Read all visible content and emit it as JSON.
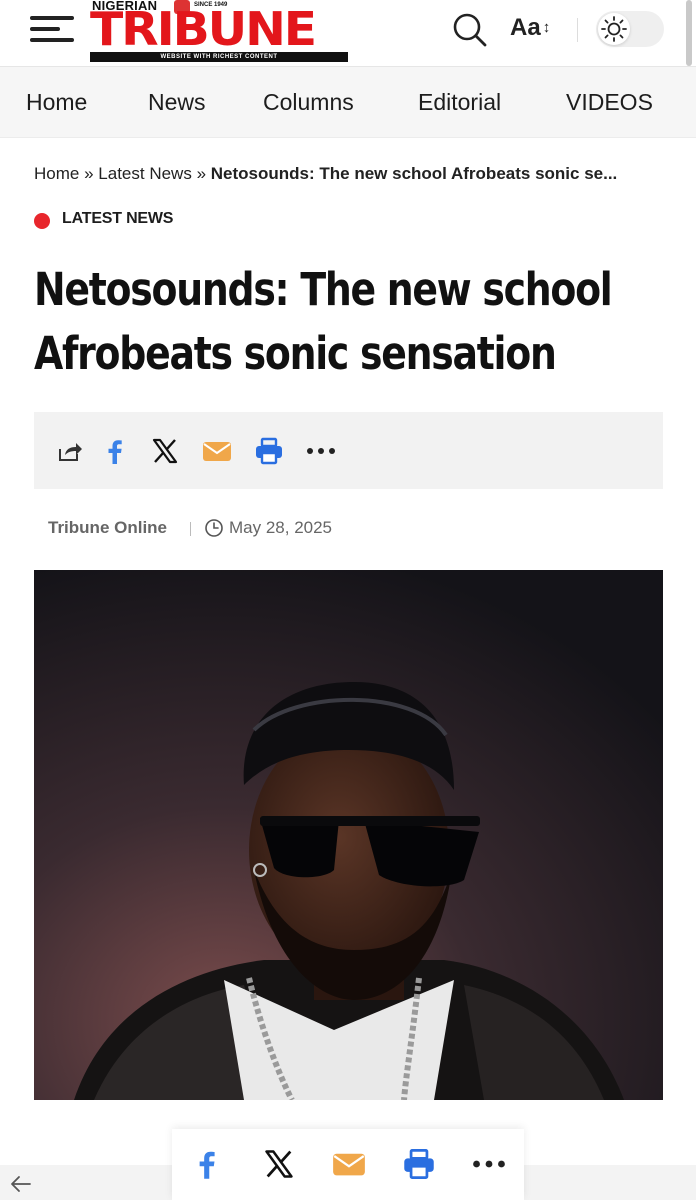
{
  "header": {
    "logo": {
      "top": "NIGERIAN",
      "since": "SINCE 1949",
      "name": "TRIBUNE",
      "tagline": "WEBSITE WITH RICHEST CONTENT"
    },
    "font_label": "Aa",
    "font_arrows": "↕",
    "icons": [
      "menu-icon",
      "search-icon",
      "font-size-icon",
      "sun-icon"
    ]
  },
  "nav": {
    "items": [
      "Home",
      "News",
      "Columns",
      "Editorial",
      "VIDEOS"
    ]
  },
  "breadcrumb": {
    "home": "Home",
    "section": "Latest News",
    "separator": "»",
    "current": "Netosounds: The new school Afrobeats sonic se..."
  },
  "category": "LATEST NEWS",
  "article": {
    "title_line1": "Netosounds: The new school",
    "title_line2": "Afrobeats sonic sensation",
    "author": "Tribune Online",
    "date": "May 28, 2025"
  },
  "share": {
    "icons": [
      "share-icon",
      "facebook-icon",
      "x-icon",
      "email-icon",
      "print-icon",
      "more-icon"
    ]
  },
  "colors": {
    "brand_red": "#e3161b",
    "category_dot": "#e8262c",
    "facebook": "#3b82e8",
    "email": "#f0a74a",
    "print": "#2a6ee0",
    "dark": "#111111"
  }
}
